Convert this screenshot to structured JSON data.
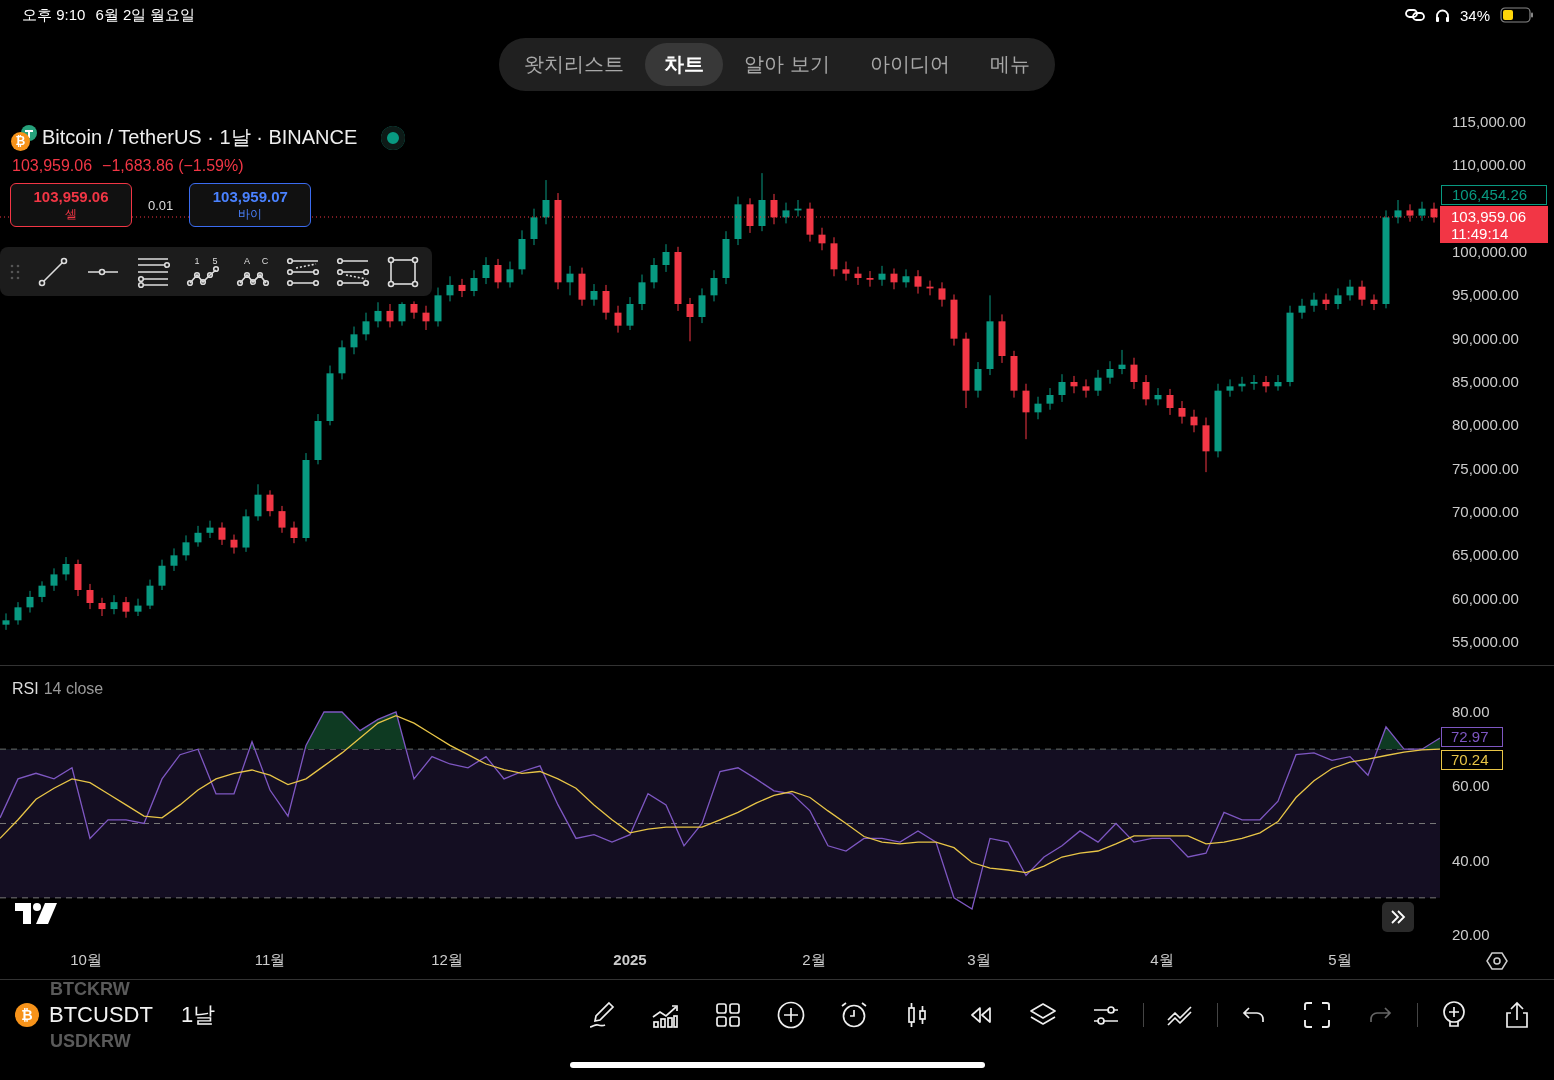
{
  "status_bar": {
    "time": "오후 9:10",
    "date": "6월 2일 월요일",
    "battery": "34%"
  },
  "nav_tabs": [
    {
      "label": "왓치리스트",
      "selected": false
    },
    {
      "label": "차트",
      "selected": true
    },
    {
      "label": "알아 보기",
      "selected": false
    },
    {
      "label": "아이디어",
      "selected": false
    },
    {
      "label": "메뉴",
      "selected": false
    }
  ],
  "symbol": {
    "coin_symbol": "₿",
    "title": "Bitcoin / TetherUS · 1날 · BINANCE",
    "market_open": true,
    "price": "103,959.06",
    "change": "−1,683.86 (−1.59%)"
  },
  "trade": {
    "sell": {
      "price": "103,959.06",
      "label": "셀"
    },
    "spread": "0.01",
    "buy": {
      "price": "103,959.07",
      "label": "바이"
    }
  },
  "drawing_tools": {
    "wave_labels": [
      "1",
      "5"
    ],
    "pattern_labels": [
      "A",
      "C"
    ]
  },
  "price_axis": {
    "high_label": "106,454.26",
    "last_price": "103,959.06",
    "countdown": "11:49:14",
    "chart_data": {
      "type": "candlestick",
      "ylim": [
        55000,
        115000
      ],
      "yticks": [
        {
          "value": 115000,
          "label": "115,000.00"
        },
        {
          "value": 110000,
          "label": "110,000.00"
        },
        {
          "value": 100000,
          "label": "100,000.00"
        },
        {
          "value": 95000,
          "label": "95,000.00"
        },
        {
          "value": 90000,
          "label": "90,000.00"
        },
        {
          "value": 85000,
          "label": "85,000.00"
        },
        {
          "value": 80000,
          "label": "80,000.00"
        },
        {
          "value": 75000,
          "label": "75,000.00"
        },
        {
          "value": 70000,
          "label": "70,000.00"
        },
        {
          "value": 65000,
          "label": "65,000.00"
        },
        {
          "value": 60000,
          "label": "60,000.00"
        },
        {
          "value": 55000,
          "label": "55,000.00"
        }
      ],
      "categories": [
        null,
        null,
        null,
        null,
        null,
        null,
        null,
        null,
        null,
        null,
        null,
        null,
        null,
        null,
        null,
        null,
        null,
        null,
        null,
        null,
        null,
        null,
        null,
        null,
        null,
        null,
        null,
        null,
        null,
        null,
        null,
        null,
        null,
        null,
        null,
        null,
        null,
        null,
        null,
        null,
        null,
        null,
        null,
        null,
        null,
        null,
        null,
        null,
        null,
        null,
        null,
        null,
        null,
        null,
        null,
        null,
        null,
        null,
        null,
        null,
        null,
        null,
        null,
        null,
        null,
        null,
        null,
        null,
        null,
        null,
        null,
        null,
        null,
        null,
        null,
        null,
        null,
        null,
        null,
        null,
        null,
        null,
        null,
        null,
        null,
        null,
        null,
        null,
        null,
        null,
        null,
        null,
        null,
        null,
        null,
        null,
        null,
        null,
        null,
        null,
        null,
        null,
        null,
        null,
        null,
        null,
        null,
        null,
        null,
        null,
        null,
        null,
        null,
        null,
        null,
        null,
        null,
        null,
        null,
        null
      ],
      "ohlc": [
        [
          57000,
          58300,
          56400,
          57500
        ],
        [
          57500,
          59600,
          57000,
          59000
        ],
        [
          59000,
          60900,
          58400,
          60200
        ],
        [
          60200,
          62000,
          59600,
          61500
        ],
        [
          61500,
          63500,
          60900,
          62800
        ],
        [
          62800,
          64800,
          62100,
          64000
        ],
        [
          64000,
          64500,
          60300,
          61000
        ],
        [
          61000,
          61700,
          58800,
          59500
        ],
        [
          59500,
          60100,
          58000,
          58800
        ],
        [
          58800,
          60400,
          58200,
          59600
        ],
        [
          59600,
          60200,
          57800,
          58500
        ],
        [
          58500,
          60000,
          58000,
          59200
        ],
        [
          59200,
          62200,
          58800,
          61500
        ],
        [
          61500,
          64500,
          61000,
          63800
        ],
        [
          63800,
          65800,
          63200,
          65000
        ],
        [
          65000,
          67300,
          64400,
          66500
        ],
        [
          66500,
          68400,
          66000,
          67600
        ],
        [
          67600,
          69000,
          67000,
          68200
        ],
        [
          68200,
          68800,
          66200,
          66800
        ],
        [
          66800,
          67400,
          65200,
          65900
        ],
        [
          65900,
          70300,
          65400,
          69500
        ],
        [
          69500,
          73200,
          69000,
          72000
        ],
        [
          72000,
          72500,
          69500,
          70100
        ],
        [
          70100,
          70700,
          67600,
          68200
        ],
        [
          68200,
          68900,
          66400,
          67000
        ],
        [
          67000,
          76800,
          66600,
          76000
        ],
        [
          76000,
          81300,
          75500,
          80500
        ],
        [
          80500,
          86900,
          80000,
          86000
        ],
        [
          86000,
          89800,
          85300,
          89000
        ],
        [
          89000,
          91400,
          88200,
          90500
        ],
        [
          90500,
          93000,
          89800,
          92000
        ],
        [
          92000,
          94200,
          91300,
          93200
        ],
        [
          93200,
          94000,
          91300,
          92000
        ],
        [
          92000,
          94200,
          91500,
          94000
        ],
        [
          94000,
          94300,
          92300,
          93000
        ],
        [
          93000,
          93800,
          91000,
          92000
        ],
        [
          92000,
          95900,
          91400,
          95000
        ],
        [
          95000,
          97200,
          94300,
          96200
        ],
        [
          96200,
          96900,
          94800,
          95500
        ],
        [
          95500,
          97900,
          94900,
          97000
        ],
        [
          97000,
          99400,
          96300,
          98500
        ],
        [
          98500,
          99200,
          95800,
          96500
        ],
        [
          96500,
          98900,
          95900,
          98000
        ],
        [
          98000,
          102500,
          97400,
          101500
        ],
        [
          101500,
          105000,
          100800,
          104000
        ],
        [
          104000,
          108300,
          103200,
          106000
        ],
        [
          106000,
          106800,
          95700,
          96500
        ],
        [
          96500,
          98400,
          95000,
          97500
        ],
        [
          97500,
          98200,
          93800,
          94500
        ],
        [
          94500,
          96300,
          93800,
          95500
        ],
        [
          95500,
          96200,
          92200,
          93000
        ],
        [
          93000,
          93800,
          90700,
          91500
        ],
        [
          91500,
          94800,
          91000,
          94000
        ],
        [
          94000,
          97400,
          93300,
          96500
        ],
        [
          96500,
          99300,
          95800,
          98500
        ],
        [
          98500,
          100900,
          97700,
          100000
        ],
        [
          100000,
          100600,
          93200,
          94000
        ],
        [
          94000,
          94700,
          89700,
          92500
        ],
        [
          92500,
          95800,
          91800,
          95000
        ],
        [
          95000,
          97900,
          94300,
          97000
        ],
        [
          97000,
          102400,
          96300,
          101500
        ],
        [
          101500,
          106400,
          100800,
          105500
        ],
        [
          105500,
          106200,
          102200,
          103000
        ],
        [
          103000,
          109100,
          102400,
          106000
        ],
        [
          106000,
          106700,
          103200,
          104000
        ],
        [
          104000,
          105700,
          103300,
          104800
        ],
        [
          104800,
          106000,
          104100,
          105000
        ],
        [
          105000,
          105700,
          101200,
          102000
        ],
        [
          102000,
          102800,
          100200,
          101000
        ],
        [
          101000,
          101700,
          97200,
          98000
        ],
        [
          98000,
          98900,
          96700,
          97500
        ],
        [
          97500,
          98300,
          96200,
          97000
        ],
        [
          97000,
          97800,
          96000,
          96800
        ],
        [
          96800,
          98400,
          96100,
          97500
        ],
        [
          97500,
          98100,
          95700,
          96500
        ],
        [
          96500,
          98000,
          95900,
          97200
        ],
        [
          97200,
          97900,
          95200,
          96000
        ],
        [
          96000,
          96700,
          95000,
          95800
        ],
        [
          95800,
          96500,
          93700,
          94500
        ],
        [
          94500,
          95100,
          89200,
          90000
        ],
        [
          90000,
          90700,
          82000,
          84000
        ],
        [
          84000,
          87300,
          83200,
          86500
        ],
        [
          86500,
          95000,
          85800,
          92000
        ],
        [
          92000,
          92800,
          87200,
          88000
        ],
        [
          88000,
          88600,
          83200,
          84000
        ],
        [
          84000,
          84800,
          78400,
          81500
        ],
        [
          81500,
          83300,
          80700,
          82500
        ],
        [
          82500,
          84300,
          81800,
          83500
        ],
        [
          83500,
          85900,
          82700,
          85000
        ],
        [
          85000,
          85700,
          83700,
          84500
        ],
        [
          84500,
          85300,
          83200,
          84000
        ],
        [
          84000,
          86400,
          83400,
          85500
        ],
        [
          85500,
          87400,
          84800,
          86500
        ],
        [
          86500,
          88700,
          85900,
          87000
        ],
        [
          87000,
          87800,
          84200,
          85000
        ],
        [
          85000,
          85800,
          82300,
          83000
        ],
        [
          83000,
          84300,
          82300,
          83500
        ],
        [
          83500,
          84200,
          81200,
          82000
        ],
        [
          82000,
          82800,
          80200,
          81000
        ],
        [
          81000,
          81800,
          79200,
          80000
        ],
        [
          80000,
          80900,
          74600,
          77000
        ],
        [
          77000,
          84800,
          76300,
          84000
        ],
        [
          84000,
          85300,
          83300,
          84500
        ],
        [
          84500,
          85600,
          83900,
          84800
        ],
        [
          84800,
          85800,
          84100,
          85000
        ],
        [
          85000,
          85700,
          83800,
          84500
        ],
        [
          84500,
          85800,
          84000,
          85000
        ],
        [
          85000,
          93800,
          84500,
          93000
        ],
        [
          93000,
          94600,
          92300,
          93800
        ],
        [
          93800,
          95300,
          93100,
          94500
        ],
        [
          94500,
          95200,
          93300,
          94000
        ],
        [
          94000,
          95800,
          93400,
          95000
        ],
        [
          95000,
          96800,
          94400,
          96000
        ],
        [
          96000,
          96700,
          93800,
          94500
        ],
        [
          94500,
          95100,
          93300,
          94000
        ],
        [
          94000,
          104800,
          93500,
          104000
        ],
        [
          104000,
          106000,
          103300,
          104800
        ],
        [
          104800,
          105500,
          103500,
          104200
        ],
        [
          104200,
          105800,
          103600,
          105000
        ],
        [
          105000,
          105700,
          103400,
          104000
        ]
      ]
    }
  },
  "rsi": {
    "name": "RSI",
    "params": "14 close",
    "value": "72.97",
    "ma_value": "70.24",
    "chart_data": {
      "type": "line",
      "ylim": [
        20,
        80
      ],
      "yticks": [
        {
          "value": 80,
          "label": "80.00"
        },
        {
          "value": 60,
          "label": "60.00"
        },
        {
          "value": 40,
          "label": "40.00"
        },
        {
          "value": 20,
          "label": "20.00"
        }
      ],
      "categories": [
        null,
        null,
        null,
        null,
        null,
        null,
        null,
        null,
        null,
        null,
        null,
        null,
        null,
        null,
        null,
        null,
        null,
        null,
        null,
        null,
        null,
        null,
        null,
        null,
        null,
        null,
        null,
        null,
        null,
        null,
        null,
        null,
        null,
        null,
        null,
        null,
        null,
        null,
        null,
        null,
        null,
        null,
        null,
        null,
        null,
        null,
        null,
        null,
        null,
        null,
        null,
        null,
        null,
        null,
        null,
        null,
        null,
        null,
        null,
        null,
        null,
        null,
        null,
        null,
        null,
        null,
        null,
        null,
        null,
        null,
        null,
        null,
        null,
        null,
        null,
        null,
        null,
        null,
        null,
        null,
        null
      ],
      "series": [
        {
          "color": "#7e57c2",
          "values": [
            51.5,
            62,
            63.5,
            62,
            65,
            46,
            51,
            51,
            50,
            62,
            68.5,
            70,
            58,
            58,
            72,
            59,
            52,
            71,
            80,
            80,
            75,
            78,
            80,
            62,
            68,
            66,
            65,
            68,
            62,
            64,
            65.5,
            55,
            46,
            47,
            45,
            47,
            58,
            55,
            44,
            50,
            64,
            65,
            62,
            58.8,
            58,
            53.4,
            44,
            42.6,
            46,
            46,
            45,
            48,
            45,
            30,
            27,
            46,
            45,
            36,
            41,
            44,
            48,
            45,
            50,
            45,
            46,
            46,
            41,
            42,
            53,
            51,
            51,
            56,
            68.5,
            69,
            67,
            68,
            63,
            76,
            70,
            70,
            73
          ]
        },
        {
          "color": "#e8c547",
          "values": [
            46,
            51,
            56.5,
            59.5,
            62,
            61,
            58,
            55,
            52,
            51.5,
            55,
            59,
            62,
            63.5,
            64.4,
            63,
            60.5,
            62,
            65.5,
            69,
            73,
            77,
            79,
            77,
            74,
            71,
            68.5,
            66,
            64.5,
            63.5,
            64,
            62,
            59.5,
            55,
            51,
            47.5,
            48.5,
            49,
            49,
            49,
            51,
            53,
            55.5,
            57.6,
            58.6,
            57,
            53.4,
            50,
            46.5,
            45,
            44.5,
            45,
            45,
            43.5,
            39.5,
            38,
            37.5,
            36.8,
            38.5,
            41,
            42,
            42.6,
            44.5,
            46.7,
            46.7,
            46.7,
            46.7,
            44.5,
            45,
            46,
            47.5,
            50.5,
            57,
            61.5,
            64.8,
            66.5,
            67.3,
            68.3,
            69.2,
            69.8,
            70
          ]
        }
      ]
    }
  },
  "time_axis": [
    {
      "label": "10월",
      "kind": "month"
    },
    {
      "label": "11월",
      "kind": "month"
    },
    {
      "label": "12월",
      "kind": "month"
    },
    {
      "label": "2025",
      "kind": "year"
    },
    {
      "label": "2월",
      "kind": "month"
    },
    {
      "label": "3월",
      "kind": "month"
    },
    {
      "label": "4월",
      "kind": "month"
    },
    {
      "label": "5월",
      "kind": "month"
    }
  ],
  "bottom_bar": {
    "symbol_above": "BTCKRW",
    "coin_symbol": "₿",
    "symbol": "BTCUSDT",
    "symbol_below": "USDKRW",
    "interval": "1날",
    "redo_disabled": true
  }
}
